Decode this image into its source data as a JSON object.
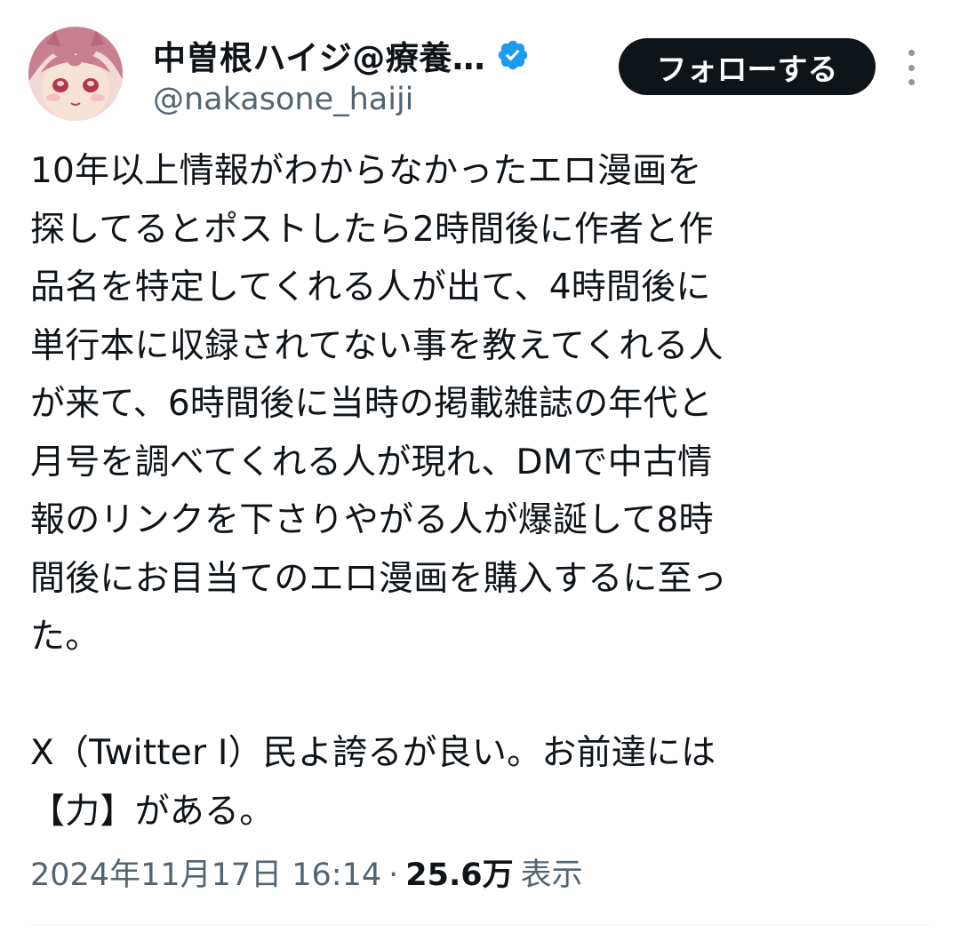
{
  "author": {
    "display_name": "中曽根ハイジ@療養…",
    "handle": "@nakasone_haiji",
    "verified": true,
    "avatar": "anime-girl-avatar"
  },
  "actions": {
    "follow_label": "フォローする",
    "more_icon": "more-vertical-icon"
  },
  "tweet": {
    "lines": [
      "10年以上情報がわからなかったエロ漫画を",
      "探してるとポストしたら2時間後に作者と作",
      "品名を特定してくれる人が出て、4時間後に",
      "単行本に収録されてない事を教えてくれる人",
      "が来て、6時間後に当時の掲載雑誌の年代と",
      "月号を調べてくれる人が現れ、DMで中古情",
      "報のリンクを下さりやがる人が爆誕して8時",
      "間後にお目当てのエロ漫画を購入するに至っ",
      "た。",
      "",
      "X（Twitter I）民よ誇るが良い。お前達には",
      "【力】がある。"
    ]
  },
  "meta": {
    "timestamp": "2024年11月17日 16:14",
    "separator": "·",
    "views_count": "25.6万",
    "views_label": "表示"
  },
  "colors": {
    "text": "#0f1419",
    "muted": "#536471",
    "verified_badge": "#1d9bf0",
    "button_bg": "#0f1419",
    "button_text": "#ffffff"
  }
}
